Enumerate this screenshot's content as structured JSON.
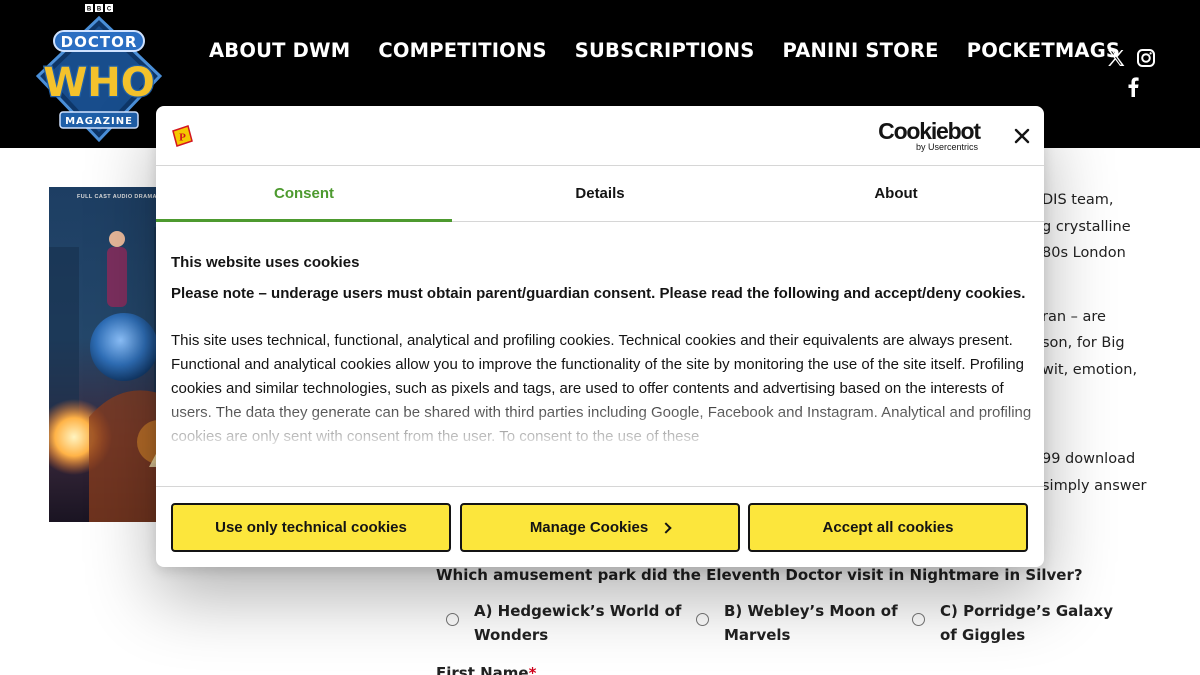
{
  "header": {
    "logo": {
      "bbc": "BBC",
      "doctor": "DOCTOR",
      "who": "WHO",
      "magazine": "MAGAZINE"
    },
    "nav": [
      {
        "label": "ABOUT DWM"
      },
      {
        "label": "COMPETITIONS"
      },
      {
        "label": "SUBSCRIPTIONS"
      },
      {
        "label": "PANINI STORE"
      },
      {
        "label": "POCKETMAGS"
      }
    ],
    "social": [
      "x-icon",
      "instagram-icon",
      "facebook-icon"
    ]
  },
  "page": {
    "cover_tag": "FULL CAST AUDIO DRAMA",
    "right_text": [
      "DIS team,",
      "g crystalline",
      "80s London",
      "ran – are",
      "son, for Big",
      "wit, emotion,",
      "99 download",
      "simply answer"
    ],
    "question": "Which amusement park did the Eleventh Doctor visit in Nightmare in Silver?",
    "answers": [
      {
        "line1": "A) Hedgewick’s World of",
        "line2": "Wonders"
      },
      {
        "line1": "B) Webley’s Moon of",
        "line2": "Marvels"
      },
      {
        "line1": "C) Porridge’s Galaxy",
        "line2": "of Giggles"
      }
    ],
    "first_name_label": "First Name",
    "required_mark": "*"
  },
  "cookie_dialog": {
    "brand_logo": {
      "name": "Cookiebot",
      "byline": "by Usercentrics"
    },
    "tabs": [
      {
        "label": "Consent",
        "active": true
      },
      {
        "label": "Details",
        "active": false
      },
      {
        "label": "About",
        "active": false
      }
    ],
    "title": "This website uses cookies",
    "note": "Please note – underage users must obtain parent/guardian consent. Please read the following and accept/deny cookies.",
    "description": "This site uses technical, functional, analytical and profiling cookies. Technical cookies and their equivalents are always present.  Functional and analytical cookies allow you to improve the functionality of the site by monitoring the use of the site itself.  Profiling cookies and similar technologies, such as pixels and tags, are used to offer contents and advertising based on the interests of users.  The data they generate can be shared with third parties including Google, Facebook and Instagram. Analytical and profiling cookies are only sent with consent from the user.  To consent to the use of these",
    "buttons": {
      "technical": "Use only technical cookies",
      "manage": "Manage Cookies",
      "accept": "Accept all cookies"
    }
  },
  "colors": {
    "header_bg": "#000000",
    "accent_green": "#4d9a2f",
    "button_yellow": "#fce63c",
    "logo_blue": "#1f5fa8",
    "logo_yellow": "#f4c22c"
  }
}
